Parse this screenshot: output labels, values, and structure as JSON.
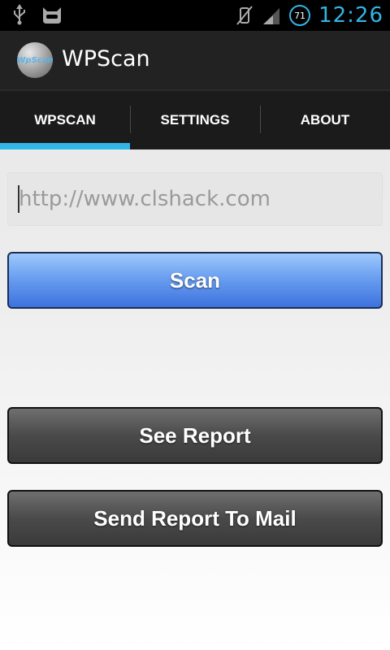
{
  "status_bar": {
    "time": "12:26",
    "battery": "71",
    "icons": [
      "usb-icon",
      "cyanogen-icon",
      "vibrate-off-icon",
      "signal-icon",
      "battery-icon"
    ]
  },
  "app": {
    "title": "WPScan",
    "logo_text": "WpScan"
  },
  "tabs": [
    {
      "label": "WPSCAN",
      "active": true
    },
    {
      "label": "SETTINGS",
      "active": false
    },
    {
      "label": "ABOUT",
      "active": false
    }
  ],
  "form": {
    "url_placeholder": "http://www.clshack.com",
    "url_value": ""
  },
  "buttons": {
    "scan": "Scan",
    "see_report": "See Report",
    "send_report": "Send Report To Mail"
  },
  "colors": {
    "accent": "#33b5e5",
    "scan_button": "#5b8fe8",
    "dark_button": "#4a4a4a"
  }
}
